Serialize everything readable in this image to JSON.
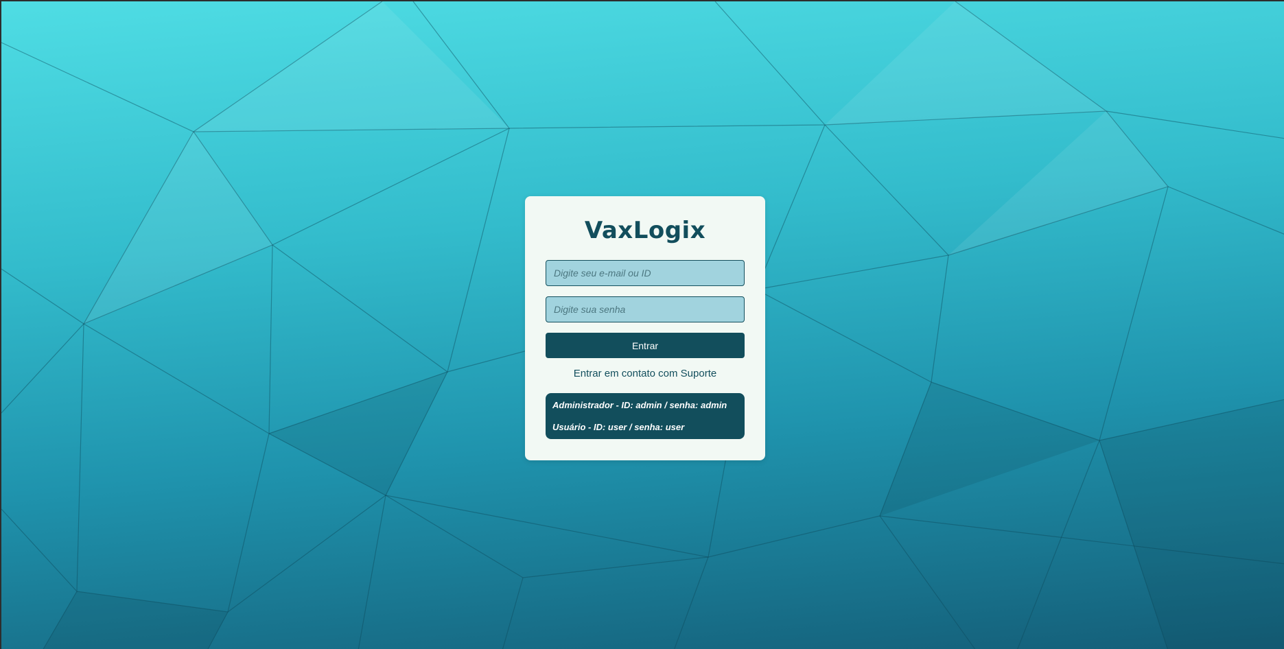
{
  "app": {
    "brand": "VaxLogix"
  },
  "login": {
    "email_placeholder": "Digite seu e-mail ou ID",
    "email_value": "",
    "password_placeholder": "Digite sua senha",
    "password_value": "",
    "submit_label": "Entrar",
    "support_link": "Entrar em contato com Suporte"
  },
  "credentials_hint": {
    "lines": [
      "Administrador - ID: admin / senha: admin",
      "Usuário - ID: user / senha: user"
    ]
  },
  "colors": {
    "brand_dark": "#124e5c",
    "card_bg": "#f2f9f4",
    "input_bg": "#a1d3de",
    "background_light": "#4fdde4",
    "background_dark": "#145e78"
  }
}
